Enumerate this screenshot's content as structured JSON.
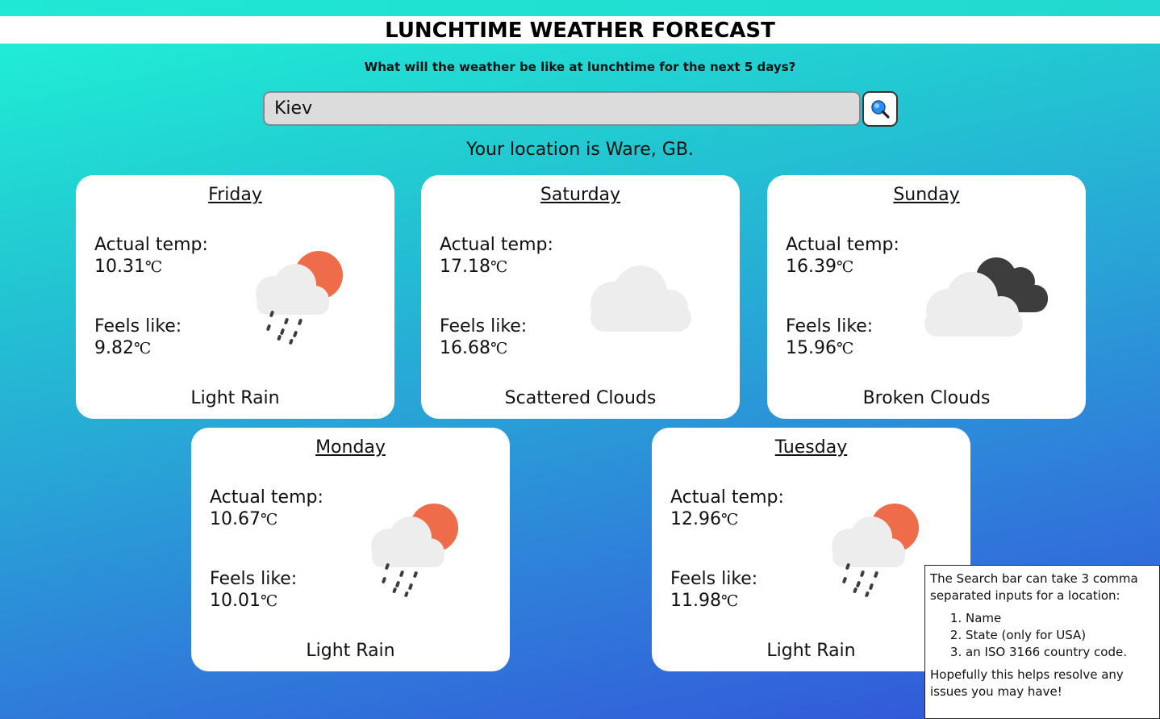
{
  "header": {
    "title": "LUNCHTIME WEATHER FORECAST",
    "subtitle": "What will the weather be like at lunchtime for the next 5 days?"
  },
  "search": {
    "value": "Kiev",
    "button_icon": "search-icon"
  },
  "location_text": "Your location is Ware, GB.",
  "labels": {
    "actual": "Actual temp:",
    "feels": "Feels like:",
    "unit": "℃"
  },
  "forecast": [
    {
      "day": "Friday",
      "actual": "10.31",
      "feels": "9.82",
      "description": "Light Rain",
      "icon": "light-rain-icon"
    },
    {
      "day": "Saturday",
      "actual": "17.18",
      "feels": "16.68",
      "description": "Scattered Clouds",
      "icon": "scattered-clouds-icon"
    },
    {
      "day": "Sunday",
      "actual": "16.39",
      "feels": "15.96",
      "description": "Broken Clouds",
      "icon": "broken-clouds-icon"
    },
    {
      "day": "Monday",
      "actual": "10.67",
      "feels": "10.01",
      "description": "Light Rain",
      "icon": "light-rain-icon"
    },
    {
      "day": "Tuesday",
      "actual": "12.96",
      "feels": "11.98",
      "description": "Light Rain",
      "icon": "light-rain-icon"
    }
  ],
  "help": {
    "intro": "The Search bar can take 3 comma separated inputs for a location:",
    "items": [
      "Name",
      "State (only for USA)",
      "an ISO 3166 country code."
    ],
    "outro": "Hopefully this helps resolve any issues you may have!"
  },
  "colors": {
    "sun": "#ee6c4a",
    "cloud": "#ededed",
    "dark_cloud": "#3d3d3d",
    "search_icon": "#1e90ff"
  }
}
